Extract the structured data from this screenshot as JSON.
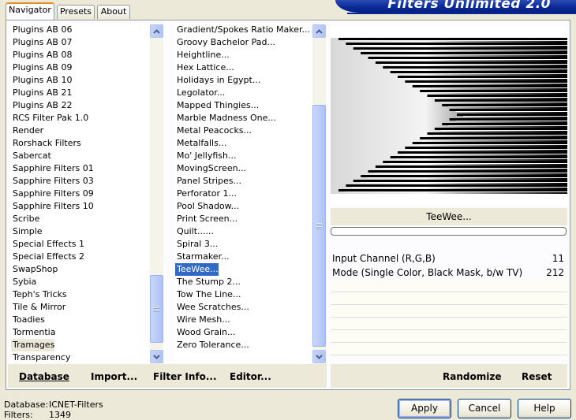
{
  "tabs": [
    {
      "label": "Navigator",
      "active": true
    },
    {
      "label": "Presets",
      "active": false
    },
    {
      "label": "About",
      "active": false
    }
  ],
  "app_title": "Filters Unlimited 2.0",
  "categories": [
    "Plugins AB 06",
    "Plugins AB 07",
    "Plugins AB 08",
    "Plugins AB 09",
    "Plugins AB 10",
    "Plugins AB 21",
    "Plugins AB 22",
    "RCS Filter Pak 1.0",
    "Render",
    "Rorshack Filters",
    "Sabercat",
    "Sapphire Filters 01",
    "Sapphire Filters 03",
    "Sapphire Filters 09",
    "Sapphire Filters 10",
    "Scribe",
    "Simple",
    "Special Effects 1",
    "Special Effects 2",
    "SwapShop",
    "Sybia",
    "Teph's Tricks",
    "Tile & Mirror",
    "Toadies",
    "Tormentia",
    "Tramages",
    "Transparency"
  ],
  "categories_selected_index": 25,
  "filters": [
    "Gradient/Spokes Ratio Maker...",
    "Groovy Bachelor Pad...",
    "Heightline...",
    "Hex Lattice...",
    "Holidays in Egypt...",
    "Legolator...",
    "Mapped Thingies...",
    "Marble Madness One...",
    "Metal Peacocks...",
    "Metalfalls...",
    "Mo' Jellyfish...",
    "MovingScreen...",
    "Panel Stripes...",
    "Perforator 1...",
    "Pool Shadow...",
    "Print Screen...",
    "Quilt......",
    "Spiral 3...",
    "Starmaker...",
    "TeeWee...",
    "The Stump 2...",
    "Tow The Line...",
    "Wee Scratches...",
    "Wire Mesh...",
    "Wood Grain...",
    "Zero Tolerance..."
  ],
  "filters_selected_index": 19,
  "toolbar": {
    "database": "Database",
    "import": "Import...",
    "filter_info": "Filter Info...",
    "editor": "Editor...",
    "randomize": "Randomize",
    "reset": "Reset"
  },
  "selected_filter_name": "TeeWee...",
  "params": [
    {
      "name": "Input Channel (R,G,B)",
      "value": "11"
    },
    {
      "name": "Mode (Single Color, Black Mask, b/w TV)",
      "value": "212"
    }
  ],
  "status": {
    "database_label": "Database:",
    "database_value": "ICNET-Filters",
    "filters_label": "Filters:",
    "filters_value": "1349"
  },
  "buttons": {
    "apply": "Apply",
    "cancel": "Cancel",
    "help": "Help"
  },
  "colors": {
    "selection": "#316ac5",
    "banner": "#0a2a9a",
    "window_bg": "#ece9d8"
  }
}
